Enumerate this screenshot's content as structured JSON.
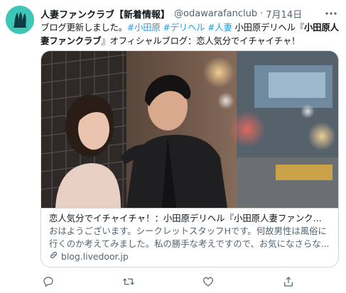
{
  "tweet": {
    "display_name": "人妻ファンクラブ【新着情報】",
    "handle": "@odawarafanclub",
    "separator": "·",
    "date": "7月14日",
    "text_lead": "ブログ更新しました。",
    "hashtags": [
      "#小田原",
      "#デリヘル",
      "#人妻"
    ],
    "text_mid": "小田原デリヘル『",
    "text_bold": "小田原人妻ファンクラブ",
    "text_tail": "』オフィシャルブログ：恋人気分でイチャイチャ！"
  },
  "card": {
    "title": "恋人気分でイチャイチャ！：小田原デリヘル『小田原人妻ファンクラブ』オフィシャルブログ",
    "description_line1": "おはようございます。シークレットスタッフHです。何故男性は風俗に",
    "description_line2": "行くのか考えてみました。私の勝手な考えですので、お気になさらな...",
    "domain": "blog.livedoor.jp"
  },
  "icons": {
    "more": "more-icon",
    "reply": "reply-icon",
    "retweet": "retweet-icon",
    "like": "like-icon",
    "share": "share-icon",
    "link": "link-icon"
  },
  "colors": {
    "accent": "#1d9bf0",
    "avatar_bg": "#3ec7b8",
    "secondary_text": "#536471"
  }
}
